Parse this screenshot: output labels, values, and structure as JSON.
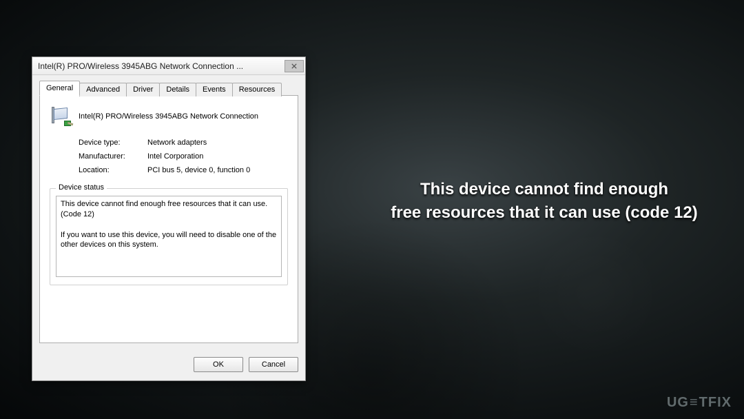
{
  "dialog": {
    "title": "Intel(R) PRO/Wireless 3945ABG Network Connection ...",
    "tabs": [
      "General",
      "Advanced",
      "Driver",
      "Details",
      "Events",
      "Resources"
    ],
    "active_tab_index": 0,
    "device_name": "Intel(R) PRO/Wireless 3945ABG Network Connection",
    "info": {
      "device_type_label": "Device type:",
      "device_type_value": "Network adapters",
      "manufacturer_label": "Manufacturer:",
      "manufacturer_value": "Intel Corporation",
      "location_label": "Location:",
      "location_value": "PCI bus 5, device 0, function 0"
    },
    "status_group_label": "Device status",
    "status_text": "This device cannot find enough free resources that it can use. (Code 12)\n\nIf you want to use this device, you will need to disable one of the other devices on this system.",
    "buttons": {
      "ok": "OK",
      "cancel": "Cancel"
    }
  },
  "caption": {
    "line1": "This device cannot find enough",
    "line2": "free resources that it can use (code 12)"
  },
  "watermark": {
    "text_left": "UG",
    "text_mid": "≡",
    "text_right": "TFIX"
  }
}
